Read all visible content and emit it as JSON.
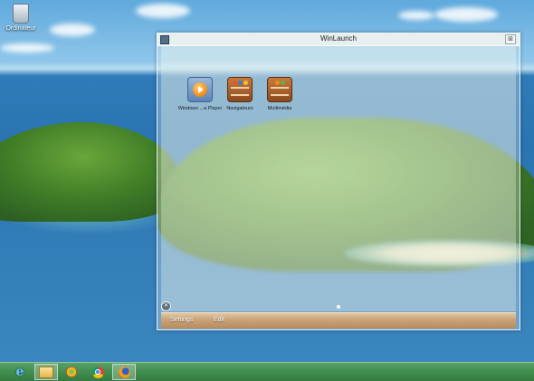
{
  "desktop": {
    "icons": [
      {
        "label": "Ordinateur",
        "icon": "recycle-bin-icon"
      }
    ]
  },
  "window": {
    "title": "WinLaunch",
    "close_label": "⊠",
    "apps": [
      {
        "label": "Windows ...a Player",
        "icon": "media-player-icon"
      },
      {
        "label": "Navigateurs",
        "icon": "shelf-folder-icon"
      },
      {
        "label": "Multimédia",
        "icon": "shelf-folder-icon"
      }
    ],
    "bottom_bar": {
      "settings_label": "Settings",
      "edit_label": "Edit"
    },
    "page_indicator": {
      "current": 1,
      "total": 1
    }
  },
  "taskbar": {
    "items": [
      {
        "name": "internet-explorer",
        "icon": "ie-icon",
        "glyph": "e",
        "active": false
      },
      {
        "name": "file-explorer",
        "icon": "folder-icon",
        "active": true
      },
      {
        "name": "winlaunch",
        "icon": "winlaunch-icon",
        "active": false
      },
      {
        "name": "chrome",
        "icon": "chrome-icon",
        "active": false
      },
      {
        "name": "firefox",
        "icon": "firefox-icon",
        "active": true
      }
    ]
  },
  "colors": {
    "taskbar": "#3f8c4d",
    "bottom_bar": "#caa47a",
    "accent_orange": "#f08a18"
  }
}
